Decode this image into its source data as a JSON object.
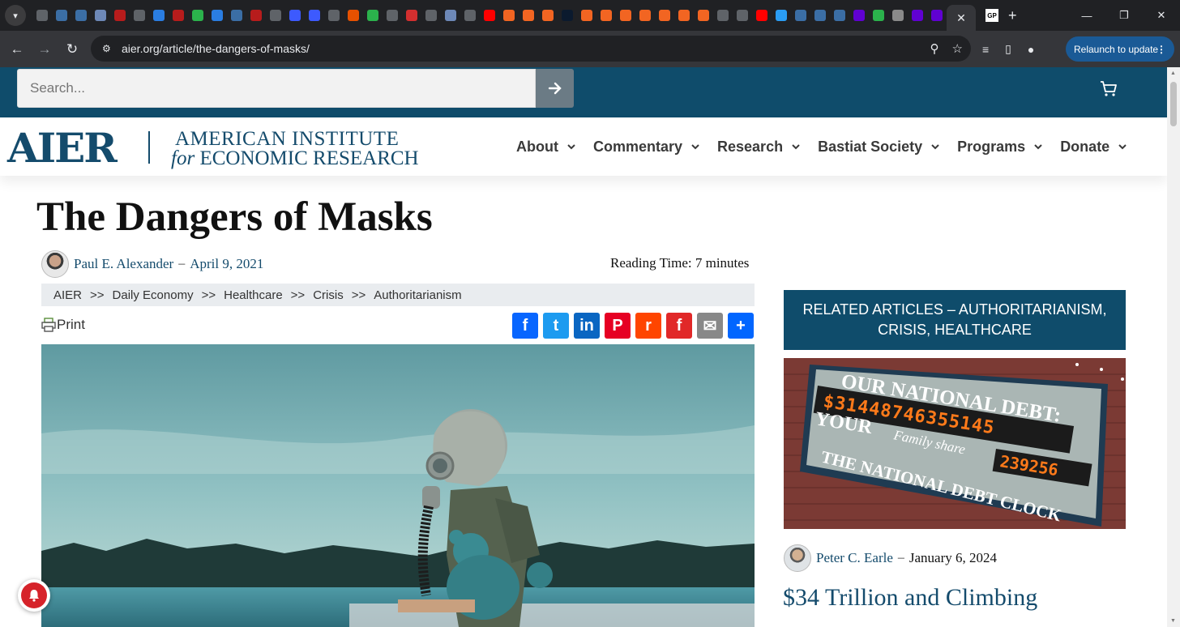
{
  "browser": {
    "url": "aier.org/article/the-dangers-of-masks/",
    "relaunch_label": "Relaunch to update",
    "tab_colors": [
      "#5f6368",
      "#3b6ea5",
      "#3b6ea5",
      "#6d88b7",
      "#b71c1c",
      "#5f6368",
      "#2a7de1",
      "#b71c1c",
      "#2bb24c",
      "#2a7de1",
      "#3b6ea5",
      "#b71c1c",
      "#5f6368",
      "#3d5afe",
      "#3d5afe",
      "#5f6368",
      "#e65100",
      "#2bb24c",
      "#5f6368",
      "#d32f2f",
      "#5f6368",
      "#6d88b7",
      "#5f6368",
      "#ff0000",
      "#f26522",
      "#f26522",
      "#f26522",
      "#0b1a2e",
      "#f26522",
      "#f26522",
      "#f26522",
      "#f26522",
      "#f26522",
      "#f26522",
      "#f26522",
      "#5f6368",
      "#5f6368",
      "#ff0000",
      "#2a9df4",
      "#3b6ea5",
      "#3b6ea5",
      "#3b6ea5",
      "#6001d2",
      "#2bb24c",
      "#8a8a8a",
      "#6001d2",
      "#6001d2"
    ],
    "active_tab_close": "✕",
    "gp_tab_label": "GP"
  },
  "header": {
    "search_placeholder": "Search...",
    "logo_short": "AIER",
    "logo_line1": "AMERICAN INSTITUTE",
    "logo_line2_italic": "for",
    "logo_line2_rest": "ECONOMIC RESEARCH",
    "nav": [
      {
        "label": "About"
      },
      {
        "label": "Commentary"
      },
      {
        "label": "Research"
      },
      {
        "label": "Bastiat Society"
      },
      {
        "label": "Programs"
      },
      {
        "label": "Donate"
      }
    ]
  },
  "article": {
    "title": "The Dangers of Masks",
    "author": "Paul E. Alexander",
    "date": "April 9, 2021",
    "dash": "–",
    "reading_time": "Reading Time: 7 minutes",
    "breadcrumbs": [
      "AIER",
      "Daily Economy",
      "Healthcare",
      "Crisis",
      "Authoritarianism"
    ],
    "crumb_sep": ">>",
    "print_label": "Print",
    "share_buttons": [
      {
        "name": "facebook",
        "color": "#0866ff",
        "glyph": "f"
      },
      {
        "name": "twitter",
        "color": "#1d9bf0",
        "glyph": "t"
      },
      {
        "name": "linkedin",
        "color": "#0a66c2",
        "glyph": "in"
      },
      {
        "name": "pinterest",
        "color": "#e60023",
        "glyph": "P"
      },
      {
        "name": "reddit",
        "color": "#ff4500",
        "glyph": "r"
      },
      {
        "name": "flipboard",
        "color": "#e12828",
        "glyph": "f"
      },
      {
        "name": "email",
        "color": "#888888",
        "glyph": "✉"
      },
      {
        "name": "share",
        "color": "#0166ff",
        "glyph": "+"
      }
    ]
  },
  "sidebar": {
    "related_header": "RELATED ARTICLES – AUTHORITARIANISM, CRISIS, HEALTHCARE",
    "related_image_text": {
      "line1": "OUR NATIONAL DEBT:",
      "debt": "$31448746355145",
      "line2": "YOUR",
      "family": "Family share",
      "family_amount": "239256",
      "line3": "THE NATIONAL DEBT CLOCK"
    },
    "related_author": "Peter C. Earle",
    "related_date": "January 6, 2024",
    "related_title": "$34 Trillion and Climbing"
  }
}
